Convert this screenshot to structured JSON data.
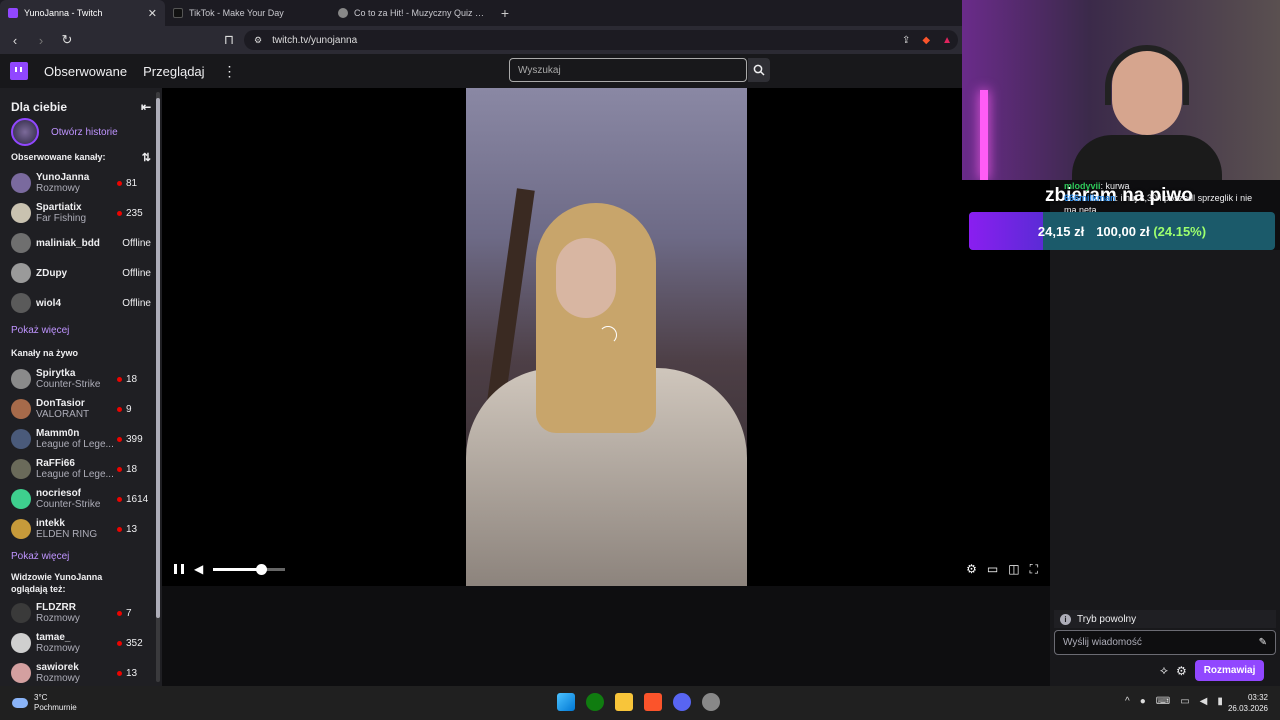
{
  "browser": {
    "tabs": [
      {
        "title": "YunoJanna - Twitch",
        "active": true,
        "favicon_color": "#9147ff"
      },
      {
        "title": "TikTok - Make Your Day",
        "active": false,
        "favicon_color": "#111111"
      },
      {
        "title": "Co to za Hit! - Muzyczny Quiz Hip-Hop",
        "active": false,
        "favicon_color": "#888888"
      }
    ],
    "url": "twitch.tv/yunojanna"
  },
  "topnav": {
    "following": "Obserwowane",
    "browse": "Przeglądaj",
    "search_placeholder": "Wyszukaj"
  },
  "sidebar": {
    "title": "Dla ciebie",
    "story_label": "Otwórz historie",
    "followed_title": "Obserwowane kanały:",
    "followed": [
      {
        "name": "YunoJanna",
        "game": "Rozmowy",
        "viewers": "81",
        "live": true,
        "avatar": "#7a6a9e"
      },
      {
        "name": "Spartiatix",
        "game": "Far Fishing",
        "viewers": "235",
        "live": true,
        "avatar": "#c9c2b0"
      },
      {
        "name": "maliniak_bdd",
        "game": "",
        "viewers": "Offline",
        "live": false,
        "avatar": "#6f6f6f"
      },
      {
        "name": "ZDupy",
        "game": "",
        "viewers": "Offline",
        "live": false,
        "avatar": "#9a9a9a"
      },
      {
        "name": "wiol4",
        "game": "",
        "viewers": "Offline",
        "live": false,
        "avatar": "#5a5a5a"
      }
    ],
    "show_more": "Pokaż więcej",
    "live_title": "Kanały na żywo",
    "live": [
      {
        "name": "Spirytka",
        "game": "Counter-Strike",
        "viewers": "18",
        "avatar": "#8a8a8a"
      },
      {
        "name": "DonTasior",
        "game": "VALORANT",
        "viewers": "9",
        "avatar": "#a66a4a"
      },
      {
        "name": "Mamm0n",
        "game": "League of Lege...",
        "viewers": "399",
        "avatar": "#4a5a7a"
      },
      {
        "name": "RaFFi66",
        "game": "League of Lege...",
        "viewers": "18",
        "avatar": "#6a6a5a"
      },
      {
        "name": "nocriesof",
        "game": "Counter-Strike",
        "viewers": "1614",
        "avatar": "#3ecf8e"
      },
      {
        "name": "intekk",
        "game": "ELDEN RING",
        "viewers": "13",
        "avatar": "#c79a3a"
      }
    ],
    "show_more_2": "Pokaż więcej",
    "also_title": "Widzowie YunoJanna oglądają też:",
    "also": [
      {
        "name": "FLDZRR",
        "game": "Rozmowy",
        "viewers": "7",
        "avatar": "#3a3a3a"
      },
      {
        "name": "tamae_",
        "game": "Rozmowy",
        "viewers": "352",
        "avatar": "#cfcfcf"
      },
      {
        "name": "sawiorek",
        "game": "Rozmowy",
        "viewers": "13",
        "avatar": "#d4a0a0"
      }
    ]
  },
  "player": {
    "volume": 0.67
  },
  "overlay": {
    "chat": [
      {
        "user": "mlodyvii",
        "text": ": kurwa"
      },
      {
        "user": "666milkman",
        "text": ": i huj 3,30 i poszedl sprzeglik i nie ma neta"
      }
    ],
    "goal_title": "zbieram na piwo",
    "goal_current": "24,15 zł",
    "goal_target": "100,00 zł",
    "goal_percent_label": "(24.15%)",
    "goal_progress": 0.2415
  },
  "chat": {
    "slow_mode": "Tryb powolny",
    "input_placeholder": "Wyślij wiadomość",
    "send_label": "Rozmawiaj"
  },
  "taskbar": {
    "temperature": "3°C",
    "weather": "Pochmurnie",
    "time": "03:32",
    "date": "26.03.2026"
  }
}
